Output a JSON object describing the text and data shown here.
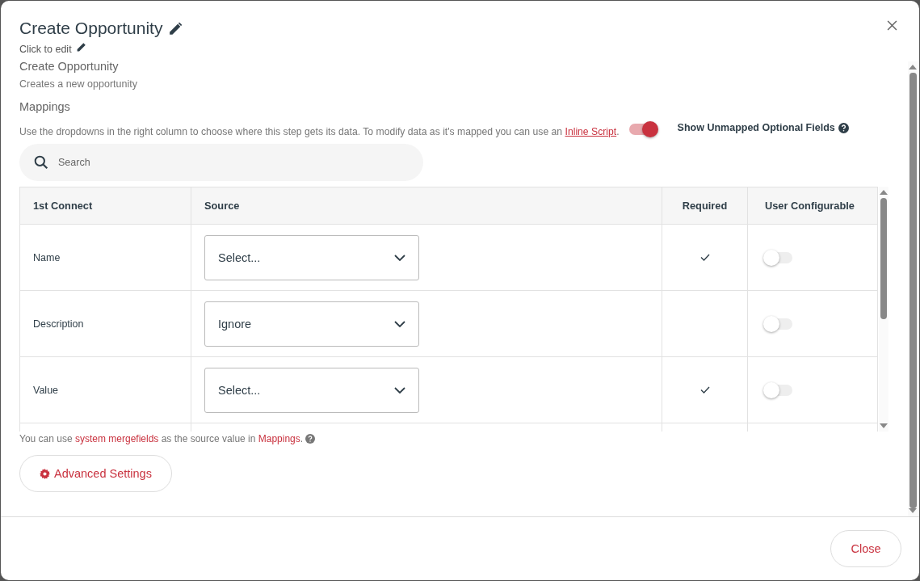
{
  "dialog": {
    "title": "Create Opportunity",
    "edit_hint": "Click to edit"
  },
  "step": {
    "name": "Create Opportunity",
    "description": "Creates a new opportunity"
  },
  "mappings": {
    "heading": "Mappings",
    "help_text": "Use the dropdowns in the right column to choose where this step gets its data. To modify data as it's mapped you can use an",
    "help_link": "Inline Script",
    "help_end": ".",
    "show_unmapped": {
      "label": "Show Unmapped Optional Fields",
      "on": true
    }
  },
  "search": {
    "placeholder": "Search"
  },
  "table": {
    "columns": [
      "1st Connect",
      "Source",
      "Required",
      "User Configurable"
    ],
    "rows": [
      {
        "field": "Name",
        "source": "Select...",
        "required": true,
        "configurable": false
      },
      {
        "field": "Description",
        "source": "Ignore",
        "required": false,
        "configurable": false
      },
      {
        "field": "Value",
        "source": "Select...",
        "required": true,
        "configurable": false
      }
    ]
  },
  "footnote": {
    "before": "You can use",
    "link1": "system mergefields",
    "middle": "as the source value in",
    "link2": "Mappings",
    "end": "."
  },
  "advanced_button": "Advanced Settings",
  "close_button": "Close"
}
